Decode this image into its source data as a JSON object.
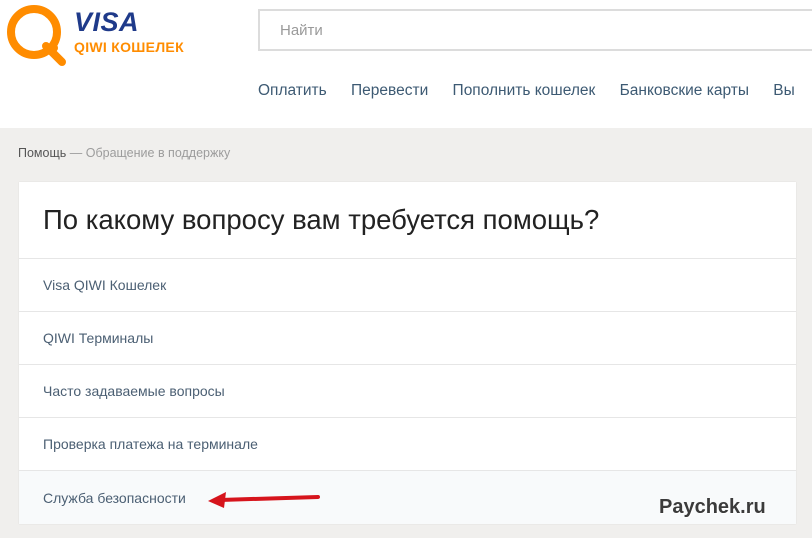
{
  "logo": {
    "brand": "VISA",
    "product": "QIWI КОШЕЛЕК"
  },
  "search": {
    "placeholder": "Найти"
  },
  "nav": {
    "items": [
      "Оплатить",
      "Перевести",
      "Пополнить кошелек",
      "Банковские карты",
      "Вы"
    ]
  },
  "breadcrumb": {
    "root": "Помощь",
    "separator": "—",
    "current": "Обращение в поддержку"
  },
  "card": {
    "title": "По какому вопросу вам требуется помощь?",
    "topics": [
      "Visa QIWI Кошелек",
      "QIWI Терминалы",
      "Часто задаваемые вопросы",
      "Проверка платежа на терминале",
      "Служба безопасности"
    ]
  },
  "watermark": "Paychek.ru",
  "colors": {
    "logo_orange": "#ff8c00",
    "logo_blue": "#1f3a8a",
    "nav_link": "#3d5a73",
    "annotation_arrow": "#d6141c",
    "page_background": "#f0efed"
  },
  "icons": {
    "logo": "qiwi-logo-icon",
    "annotation": "arrow-left-icon"
  }
}
